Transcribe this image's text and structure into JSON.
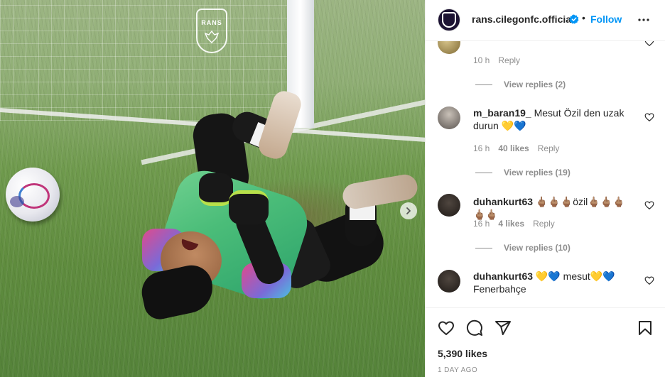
{
  "post": {
    "image_logo_text": "RANS",
    "header": {
      "username": "rans.cilegonfc.official",
      "separator": "•",
      "follow_label": "Follow",
      "verified_icon": "verified-badge-icon",
      "more_icon": "more-options-icon"
    },
    "comments": [
      {
        "username": "",
        "text": "",
        "time": "10 h",
        "likes": "",
        "reply_label": "Reply",
        "view_replies": "View replies (2)"
      },
      {
        "username": "m_baran19_",
        "text": "Mesut Özil den uzak durun 💛💙",
        "time": "16 h",
        "likes": "40 likes",
        "reply_label": "Reply",
        "view_replies": "View replies (19)"
      },
      {
        "username": "duhankurt63",
        "text": "🖕🏽🖕🏽🖕🏽özil🖕🏽🖕🏽🖕🏽🖕🏽🖕🏽",
        "time": "16 h",
        "likes": "4 likes",
        "reply_label": "Reply",
        "view_replies": "View replies (10)"
      },
      {
        "username": "duhankurt63",
        "text": "💛💙 mesut💛💙 Fenerbahçe",
        "time": "",
        "likes": "",
        "reply_label": "",
        "view_replies": ""
      }
    ],
    "likes_count": "5,390 likes",
    "time_ago": "1 DAY AGO",
    "icons": {
      "like": "heart-icon",
      "comment": "comment-icon",
      "share": "share-icon",
      "save": "bookmark-icon",
      "carousel_next": "chevron-right-icon"
    },
    "colors": {
      "follow_blue": "#0095f6",
      "text_primary": "#262626",
      "text_secondary": "#8e8e8e",
      "border": "#efefef"
    }
  }
}
